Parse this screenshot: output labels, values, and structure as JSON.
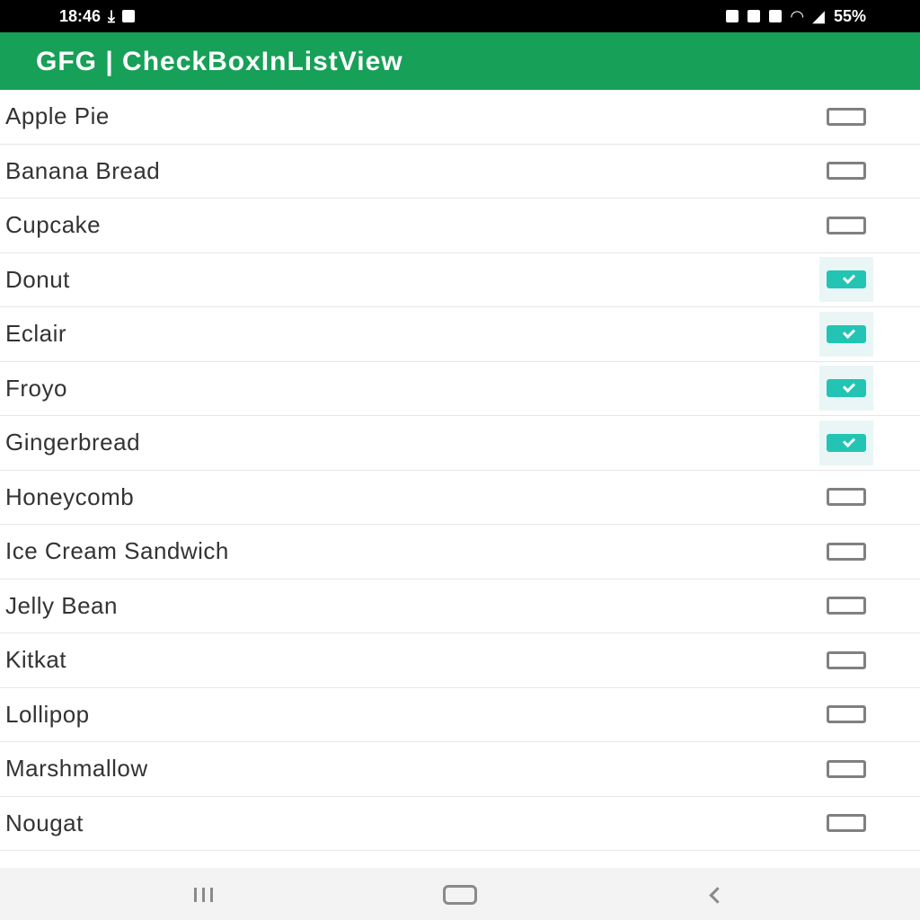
{
  "status_bar": {
    "time": "18:46",
    "left_icons": [
      "download-icon",
      "message-icon"
    ],
    "right_icons": [
      "alarm-icon",
      "nfc-icon",
      "mute-icon",
      "wifi-icon",
      "signal-icon"
    ],
    "battery": "55%"
  },
  "app_bar": {
    "title": "GFG | CheckBoxInListView",
    "color": "#17a057"
  },
  "list": {
    "items": [
      {
        "label": "Apple Pie",
        "checked": false
      },
      {
        "label": "Banana Bread",
        "checked": false
      },
      {
        "label": "Cupcake",
        "checked": false
      },
      {
        "label": "Donut",
        "checked": true
      },
      {
        "label": "Eclair",
        "checked": true
      },
      {
        "label": "Froyo",
        "checked": true
      },
      {
        "label": "Gingerbread",
        "checked": true
      },
      {
        "label": "Honeycomb",
        "checked": false
      },
      {
        "label": "Ice Cream Sandwich",
        "checked": false
      },
      {
        "label": "Jelly Bean",
        "checked": false
      },
      {
        "label": "Kitkat",
        "checked": false
      },
      {
        "label": "Lollipop",
        "checked": false
      },
      {
        "label": "Marshmallow",
        "checked": false
      },
      {
        "label": "Nougat",
        "checked": false
      }
    ],
    "checkbox_accent": "#23c4b4"
  },
  "nav_bar": {
    "buttons": [
      "recents-icon",
      "home-icon",
      "back-icon"
    ]
  }
}
